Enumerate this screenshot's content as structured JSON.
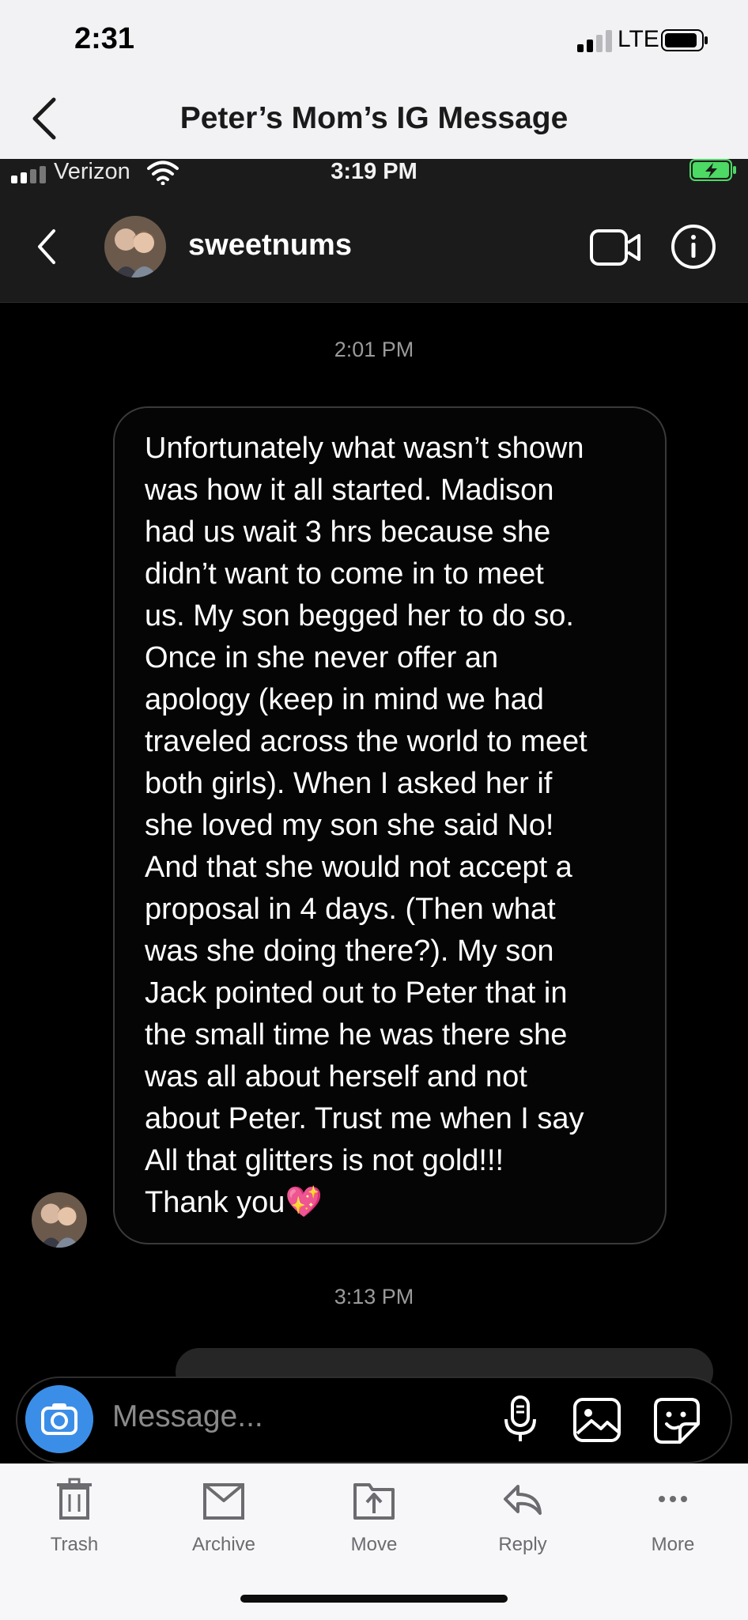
{
  "outer_status": {
    "time": "2:31",
    "network": "LTE"
  },
  "outer_nav": {
    "title": "Peter’s Mom’s IG Message"
  },
  "ig_status": {
    "carrier": "Verizon",
    "time": "3:19 PM"
  },
  "ig_header": {
    "username": "sweetnums"
  },
  "conversation": {
    "timestamp_1": "2:01 PM",
    "message_lines": [
      "Unfortunately what wasn’t shown",
      "was how it all started.  Madison",
      "had us wait 3 hrs because she",
      "didn’t want to come in to meet",
      "us. My son begged her to do so.",
      "Once in she never offer an",
      "apology (keep in mind we had",
      "traveled across the world to meet",
      "both girls). When I asked her if",
      "she loved my son she said No!",
      "And that she would not accept a",
      "proposal in 4 days. (Then what",
      "was she doing there?). My son",
      "Jack pointed out to Peter that in",
      "the small time he was there she",
      "was all about herself and not",
      "about Peter. Trust me when I say",
      "All that glitters is not gold!!!",
      "Thank you💖"
    ],
    "timestamp_2": "3:13 PM"
  },
  "composer": {
    "placeholder": "Message..."
  },
  "toolbar": {
    "items": [
      {
        "label": "Trash",
        "icon": "trash-icon"
      },
      {
        "label": "Archive",
        "icon": "archive-icon"
      },
      {
        "label": "Move",
        "icon": "move-icon"
      },
      {
        "label": "Reply",
        "icon": "reply-icon"
      },
      {
        "label": "More",
        "icon": "more-icon"
      }
    ]
  },
  "colors": {
    "accent_blue": "#3b8ee8",
    "battery_green": "#4cd964",
    "bubble_border": "#3a3a3a"
  }
}
